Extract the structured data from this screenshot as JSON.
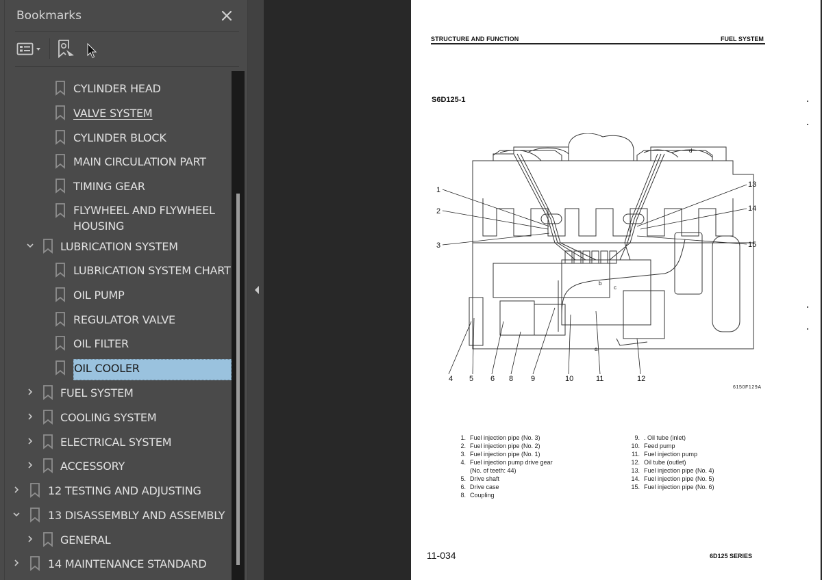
{
  "bookmarks_panel": {
    "title": "Bookmarks",
    "close_icon": "close-icon",
    "toolbar": {
      "options_icon": "list-options-icon",
      "options_dropdown_icon": "caret-down-icon",
      "find_bookmark_icon": "bookmark-search-icon"
    },
    "items": [
      {
        "label": "CYLINDER HEAD",
        "level": 2,
        "expander": "none"
      },
      {
        "label": "VALVE SYSTEM",
        "level": 2,
        "expander": "none",
        "hovered": true
      },
      {
        "label": "CYLINDER BLOCK",
        "level": 2,
        "expander": "none"
      },
      {
        "label": "MAIN CIRCULATION PART",
        "level": 2,
        "expander": "none"
      },
      {
        "label": "TIMING GEAR",
        "level": 2,
        "expander": "none"
      },
      {
        "label": "FLYWHEEL AND FLYWHEEL HOUSING",
        "level": 2,
        "expander": "none"
      },
      {
        "label": "LUBRICATION SYSTEM",
        "level": 1,
        "expander": "expanded"
      },
      {
        "label": "LUBRICATION SYSTEM CHART",
        "level": 2,
        "expander": "none"
      },
      {
        "label": "OIL PUMP",
        "level": 2,
        "expander": "none"
      },
      {
        "label": "REGULATOR VALVE",
        "level": 2,
        "expander": "none"
      },
      {
        "label": "OIL FILTER",
        "level": 2,
        "expander": "none"
      },
      {
        "label": "OIL COOLER",
        "level": 2,
        "expander": "none",
        "selected": true
      },
      {
        "label": "FUEL SYSTEM",
        "level": 1,
        "expander": "collapsed"
      },
      {
        "label": "COOLING SYSTEM",
        "level": 1,
        "expander": "collapsed"
      },
      {
        "label": "ELECTRICAL SYSTEM",
        "level": 1,
        "expander": "collapsed"
      },
      {
        "label": "ACCESSORY",
        "level": 1,
        "expander": "collapsed"
      },
      {
        "label": "12 TESTING AND ADJUSTING",
        "level": 0,
        "expander": "collapsed"
      },
      {
        "label": "13 DISASSEMBLY AND ASSEMBLY",
        "level": 0,
        "expander": "expanded"
      },
      {
        "label": "GENERAL",
        "level": 1,
        "expander": "collapsed"
      },
      {
        "label": "14 MAINTENANCE STANDARD",
        "level": 0,
        "expander": "collapsed"
      }
    ],
    "colors": {
      "selected_bg": "#9ac2de",
      "panel_bg": "#4a4a4a",
      "text": "#e2e2e2"
    }
  },
  "gutter": {
    "collapse_icon": "triangle-left-icon"
  },
  "document": {
    "header_left": "STRUCTURE AND FUNCTION",
    "header_right": "FUEL SYSTEM",
    "model": "S6D125-1",
    "figure_code": "6150F129A",
    "callouts": [
      "1",
      "2",
      "3",
      "4",
      "5",
      "6",
      "8",
      "9",
      "10",
      "11",
      "12",
      "13",
      "14",
      "15"
    ],
    "flow_marks": [
      "a",
      "b",
      "c",
      "d"
    ],
    "legend_left": [
      {
        "num": "1.",
        "text": "Fuel injection pipe (No. 3)"
      },
      {
        "num": "2.",
        "text": "Fuel injection pipe (No. 2)"
      },
      {
        "num": "3.",
        "text": "Fuel injection pipe (No. 1)"
      },
      {
        "num": "4.",
        "text": "Fuel injection pump drive gear",
        "cont": "(No. of teeth:  44)"
      },
      {
        "num": "5.",
        "text": "Drive shaft"
      },
      {
        "num": "6.",
        "text": "Drive case"
      },
      {
        "num": "8.",
        "text": "Coupling"
      }
    ],
    "legend_right": [
      {
        "num": "9.",
        "text": ". Oil tube (inlet)"
      },
      {
        "num": "10.",
        "text": "Feed pump"
      },
      {
        "num": "11.",
        "text": "Fuel injection pump"
      },
      {
        "num": "12.",
        "text": "Oil tube (outlet)"
      },
      {
        "num": "13.",
        "text": "Fuel injection pipe (No. 4)"
      },
      {
        "num": "14.",
        "text": "Fuel injection pipe (No. 5)"
      },
      {
        "num": "15.",
        "text": "Fuel injection pipe (No. 6)"
      }
    ],
    "page_number": "11-034",
    "series": "6D125 SERIES"
  }
}
